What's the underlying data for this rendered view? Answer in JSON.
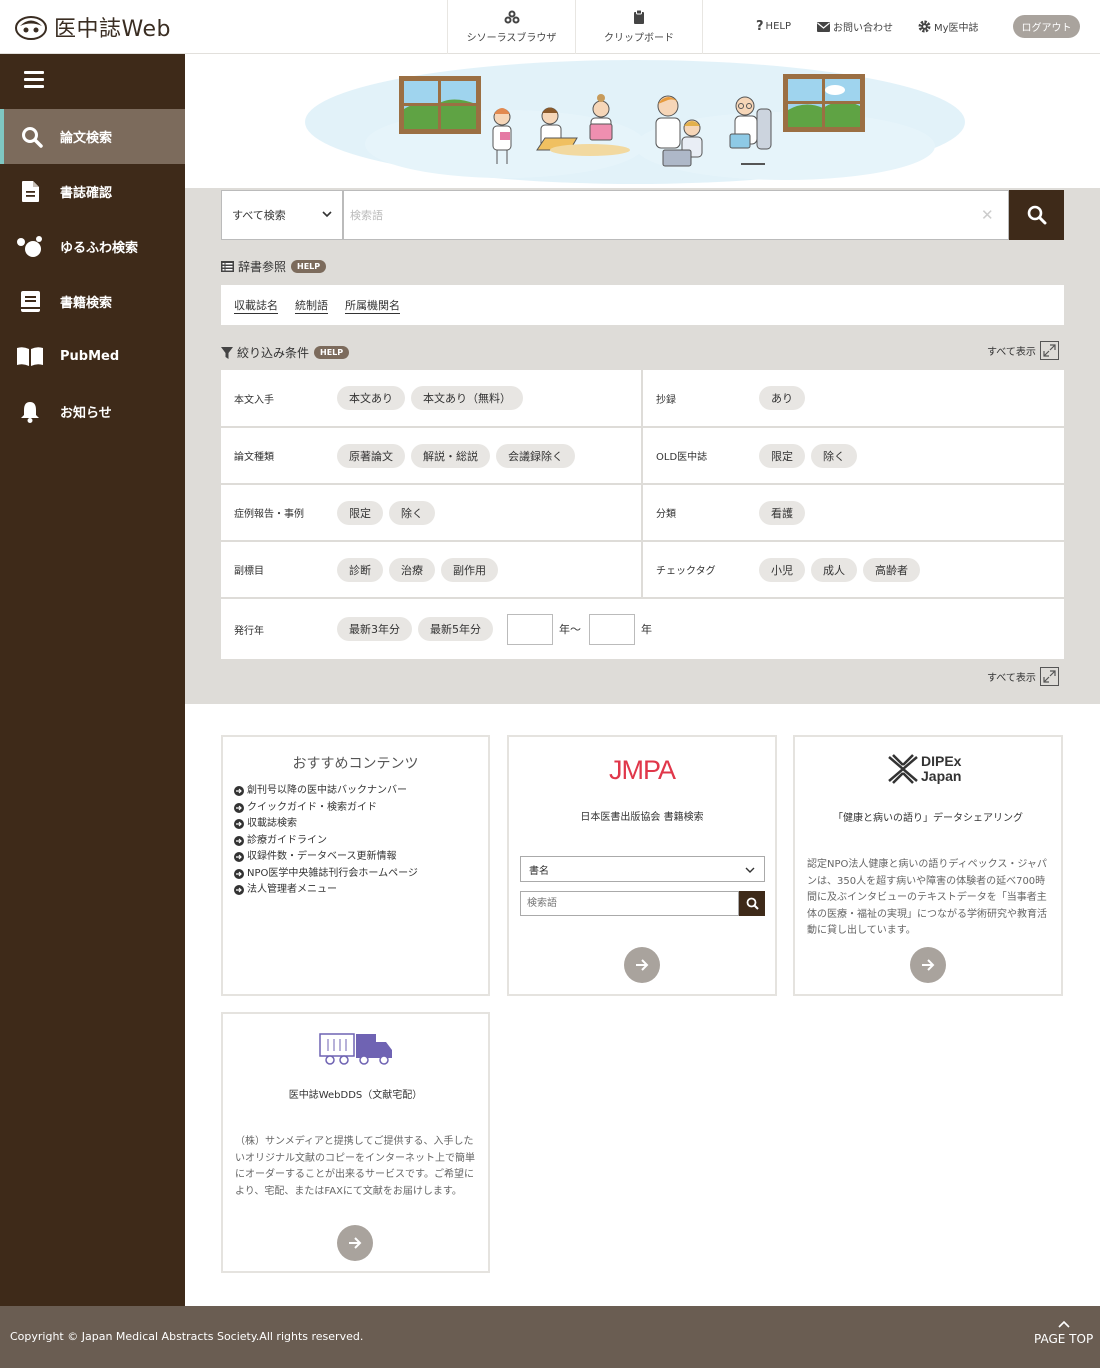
{
  "header": {
    "logo_text": "医中誌Web",
    "thesaurus_label": "シソーラスブラウザ",
    "clipboard_label": "クリップボード",
    "help_label": "HELP",
    "contact_label": "お問い合わせ",
    "my_label": "My医中誌",
    "logout_label": "ログアウト"
  },
  "sidebar": {
    "items": [
      {
        "label": "論文検索",
        "icon": "search-icon",
        "active": true
      },
      {
        "label": "書誌確認",
        "icon": "document-icon"
      },
      {
        "label": "ゆるふわ検索",
        "icon": "bubbles-icon"
      },
      {
        "label": "書籍検索",
        "icon": "book-icon"
      },
      {
        "label": "PubMed",
        "icon": "open-book-icon"
      },
      {
        "label": "お知らせ",
        "icon": "bell-icon"
      }
    ]
  },
  "search": {
    "scope_selected": "すべて検索",
    "placeholder": "検索語",
    "value": ""
  },
  "dictionary": {
    "title": "辞書参照",
    "help": "HELP",
    "links": [
      "収載誌名",
      "統制語",
      "所属機関名"
    ]
  },
  "filters": {
    "title": "絞り込み条件",
    "help": "HELP",
    "show_all": "すべて表示",
    "rows": [
      {
        "left": {
          "label": "本文入手",
          "chips": [
            "本文あり",
            "本文あり（無料）"
          ]
        },
        "right": {
          "label": "抄録",
          "chips": [
            "あり"
          ]
        }
      },
      {
        "left": {
          "label": "論文種類",
          "chips": [
            "原著論文",
            "解説・総説",
            "会議録除く"
          ]
        },
        "right": {
          "label": "OLD医中誌",
          "chips": [
            "限定",
            "除く"
          ]
        }
      },
      {
        "left": {
          "label": "症例報告・事例",
          "chips": [
            "限定",
            "除く"
          ]
        },
        "right": {
          "label": "分類",
          "chips": [
            "看護"
          ]
        }
      },
      {
        "left": {
          "label": "副標目",
          "chips": [
            "診断",
            "治療",
            "副作用"
          ]
        },
        "right": {
          "label": "チェックタグ",
          "chips": [
            "小児",
            "成人",
            "高齢者"
          ]
        }
      }
    ],
    "year": {
      "label": "発行年",
      "chips": [
        "最新3年分",
        "最新5年分"
      ],
      "from_suffix": "年〜",
      "to_suffix": "年"
    }
  },
  "cards": {
    "recommend": {
      "title": "おすすめコンテンツ",
      "links": [
        "創刊号以降の医中誌バックナンバー",
        "クイックガイド・検索ガイド",
        "収載誌検索",
        "診療ガイドライン",
        "収録件数・データベース更新情報",
        "NPO医学中央雑誌刊行会ホームページ",
        "法人管理者メニュー"
      ]
    },
    "jmpa": {
      "logo": "JMPA",
      "subtitle": "日本医書出版協会 書籍検索",
      "select_value": "書名",
      "input_placeholder": "検索語"
    },
    "dipex": {
      "logo_line1": "DIPEx",
      "logo_line2": "Japan",
      "subtitle": "「健康と病いの語り」データシェアリング",
      "desc": "認定NPO法人健康と病いの語りディペックス・ジャパンは、350人を超す病いや障害の体験者の延べ700時間に及ぶインタビューのテキストデータを「当事者主体の医療・福祉の実現」につながる学術研究や教育活動に貸し出しています。"
    },
    "dds": {
      "subtitle": "医中誌WebDDS（文献宅配）",
      "desc": "（株）サンメディアと提携してご提供する、入手したいオリジナル文献のコピーをインターネット上で簡単にオーダーすることが出来るサービスです。ご希望により、宅配、またはFAXにて文献をお届けします。"
    }
  },
  "footer": {
    "copyright": "Copyright © Japan Medical Abstracts Society.All rights reserved.",
    "page_top": "PAGE TOP"
  },
  "colors": {
    "sidebar": "#3e2a19",
    "active": "#7c6b5c",
    "accent": "#7fc7c2",
    "jmpa": "#e0374a",
    "dds": "#6f63b3"
  }
}
